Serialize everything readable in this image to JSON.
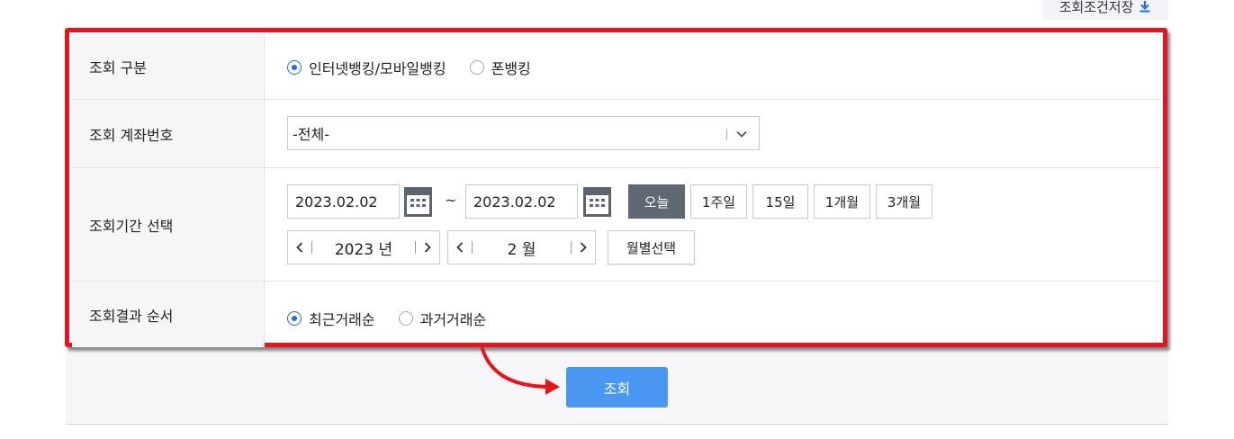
{
  "header": {
    "save_conditions_label": "조회조건저장"
  },
  "form": {
    "inquiry_type": {
      "label": "조회 구분",
      "options": [
        {
          "label": "인터넷뱅킹/모바일뱅킹",
          "selected": true
        },
        {
          "label": "폰뱅킹",
          "selected": false
        }
      ]
    },
    "account": {
      "label": "조회 계좌번호",
      "selected": "-전체-"
    },
    "period": {
      "label": "조회기간 선택",
      "start_date": "2023.02.02",
      "end_date": "2023.02.02",
      "tilde": "~",
      "quick_buttons": [
        {
          "label": "오늘",
          "active": true
        },
        {
          "label": "1주일",
          "active": false
        },
        {
          "label": "15일",
          "active": false
        },
        {
          "label": "1개월",
          "active": false
        },
        {
          "label": "3개월",
          "active": false
        }
      ],
      "year_value": "2023 년",
      "month_value": "2 월",
      "month_select_label": "월별선택"
    },
    "order": {
      "label": "조회결과 순서",
      "options": [
        {
          "label": "최근거래순",
          "selected": true
        },
        {
          "label": "과거거래순",
          "selected": false
        }
      ]
    }
  },
  "search_button_label": "조회",
  "colors": {
    "highlight": "#e8141b",
    "primary_button": "#4a97f2",
    "radio_active": "#1e6fe0",
    "active_period": "#606873"
  },
  "icons": [
    "download-icon",
    "chevron-down-icon",
    "calendar-icon",
    "chevron-left-icon",
    "chevron-right-icon",
    "curved-arrow-icon"
  ]
}
